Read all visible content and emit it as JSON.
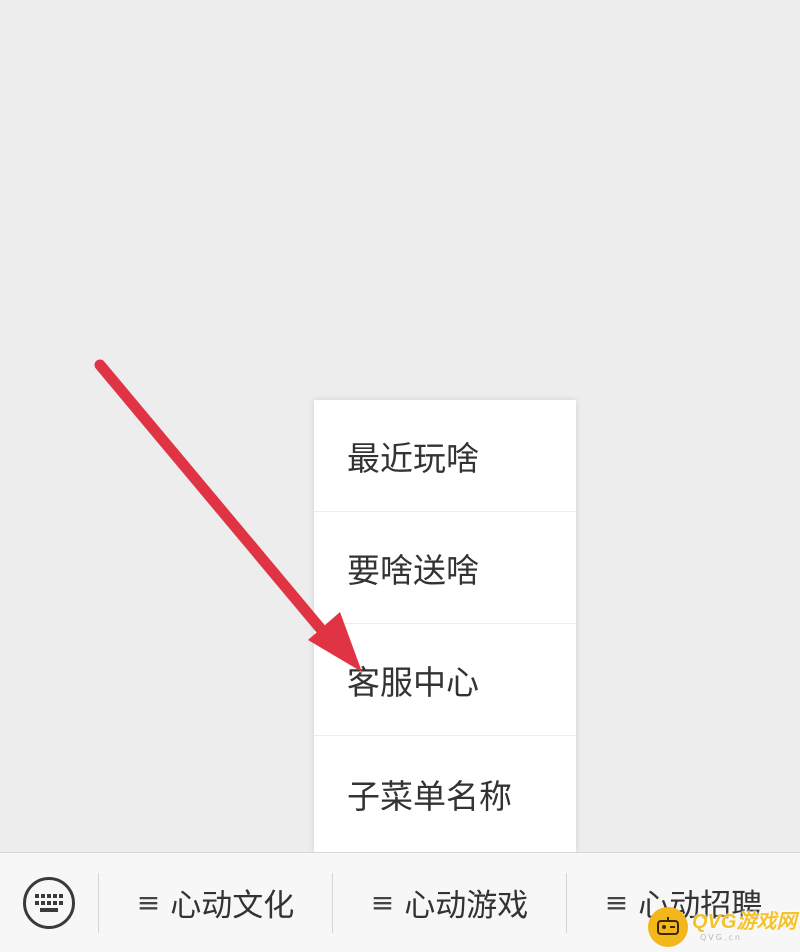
{
  "submenu": {
    "items": [
      {
        "label": "最近玩啥"
      },
      {
        "label": "要啥送啥"
      },
      {
        "label": "客服中心"
      },
      {
        "label": "子菜单名称"
      }
    ]
  },
  "bottom_menu": {
    "keyboard_icon": "keyboard-icon",
    "tabs": [
      {
        "icon": "list-icon",
        "glyph": "≡",
        "label": "心动文化"
      },
      {
        "icon": "list-icon",
        "glyph": "≡",
        "label": "心动游戏"
      },
      {
        "icon": "list-icon",
        "glyph": "≡",
        "label": "心动招聘"
      }
    ]
  },
  "annotation": {
    "arrow_color": "#e03444"
  },
  "watermark": {
    "text": "QVG游戏网",
    "sub": "QVG.cn"
  }
}
